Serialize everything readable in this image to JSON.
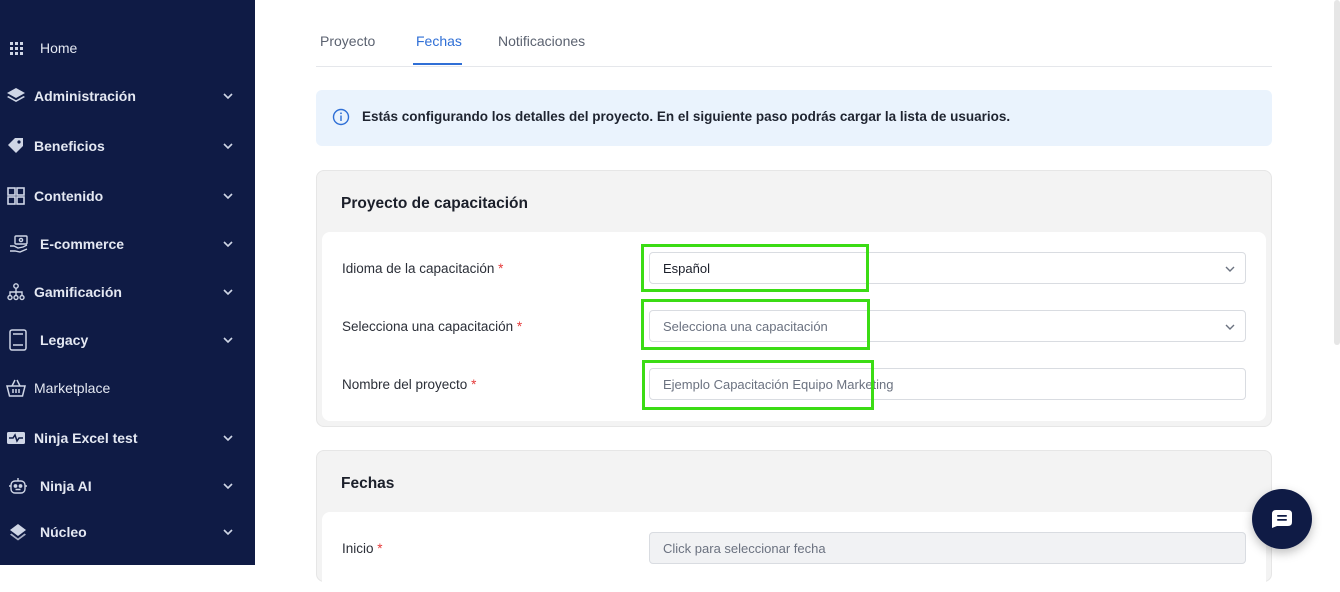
{
  "sidebar": {
    "items": [
      {
        "label": "Home",
        "icon": "grid-icon",
        "chevron": false
      },
      {
        "label": "Administración",
        "icon": "layers-icon",
        "chevron": true
      },
      {
        "label": "Beneficios",
        "icon": "tag-icon",
        "chevron": true
      },
      {
        "label": "Contenido",
        "icon": "layout-icon",
        "chevron": true
      },
      {
        "label": "E-commerce",
        "icon": "money-hand-icon",
        "chevron": true
      },
      {
        "label": "Gamificación",
        "icon": "hierarchy-icon",
        "chevron": true
      },
      {
        "label": "Legacy",
        "icon": "book-icon",
        "chevron": true
      },
      {
        "label": "Marketplace",
        "icon": "basket-icon",
        "chevron": false
      },
      {
        "label": "Ninja Excel test",
        "icon": "pulse-icon",
        "chevron": true
      },
      {
        "label": "Ninja AI",
        "icon": "robot-icon",
        "chevron": true
      },
      {
        "label": "Núcleo",
        "icon": "stack-icon",
        "chevron": true
      }
    ]
  },
  "tabs": [
    {
      "label": "Proyecto",
      "active": false
    },
    {
      "label": "Fechas",
      "active": true
    },
    {
      "label": "Notificaciones",
      "active": false
    }
  ],
  "info": {
    "text": "Estás configurando los detalles del proyecto. En el siguiente paso podrás cargar la lista de usuarios."
  },
  "project_card": {
    "title": "Proyecto de capacitación",
    "fields": {
      "language": {
        "label": "Idioma de la capacitación",
        "required": "*",
        "value": "Español"
      },
      "training": {
        "label": "Selecciona una capacitación",
        "required": "*",
        "placeholder": "Selecciona una capacitación"
      },
      "name": {
        "label": "Nombre del proyecto",
        "required": "*",
        "placeholder": "Ejemplo Capacitación Equipo Marketing"
      }
    }
  },
  "dates_card": {
    "title": "Fechas",
    "fields": {
      "start": {
        "label": "Inicio",
        "required": "*",
        "placeholder": "Click para seleccionar fecha"
      }
    }
  },
  "colors": {
    "sidebar_bg": "#0f1b45",
    "accent": "#2f6fd6",
    "highlight": "#3bdc14",
    "required": "#e53b3b"
  }
}
